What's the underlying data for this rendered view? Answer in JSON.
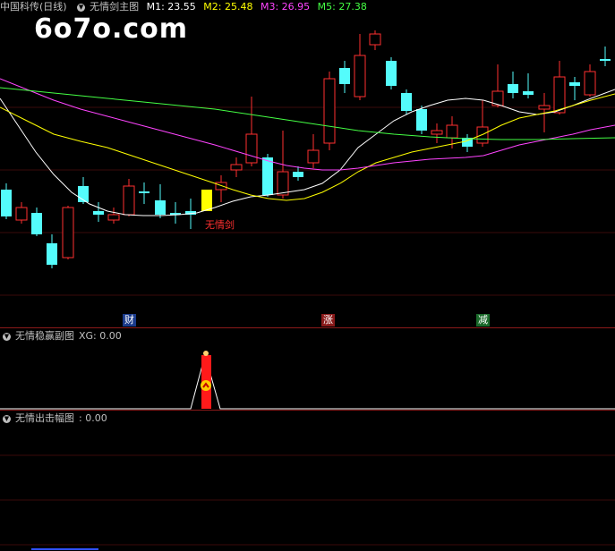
{
  "main": {
    "stock": "中国科传",
    "period": "(日线)",
    "indicator": "无情剑主图",
    "ma": [
      {
        "label": "M1: 23.55",
        "color": "#ffffff"
      },
      {
        "label": "M2: 25.48",
        "color": "#ffff00"
      },
      {
        "label": "M3: 26.95",
        "color": "#ff44ff"
      },
      {
        "label": "M5: 27.38",
        "color": "#44ff44"
      }
    ],
    "signal_label": "无情剑",
    "markers": [
      {
        "text": "财",
        "bg": "#1a3a8a",
        "color": "#ffffff"
      },
      {
        "text": "涨",
        "bg": "#8a1a1a",
        "color": "#ffffff"
      },
      {
        "text": "减",
        "bg": "#1a6a2a",
        "color": "#ffffff"
      }
    ]
  },
  "sub1": {
    "title": "无情稳赢副图",
    "value": "XG: 0.00"
  },
  "sub2": {
    "title": "无情出击幅图",
    "value": ": 0.00"
  },
  "watermark": "6o7o.com",
  "colors": {
    "up": "#ff3030",
    "down": "#54fcfc",
    "signal": "#ffff00",
    "bg": "#000000",
    "grid": "#8b1a1a"
  }
}
